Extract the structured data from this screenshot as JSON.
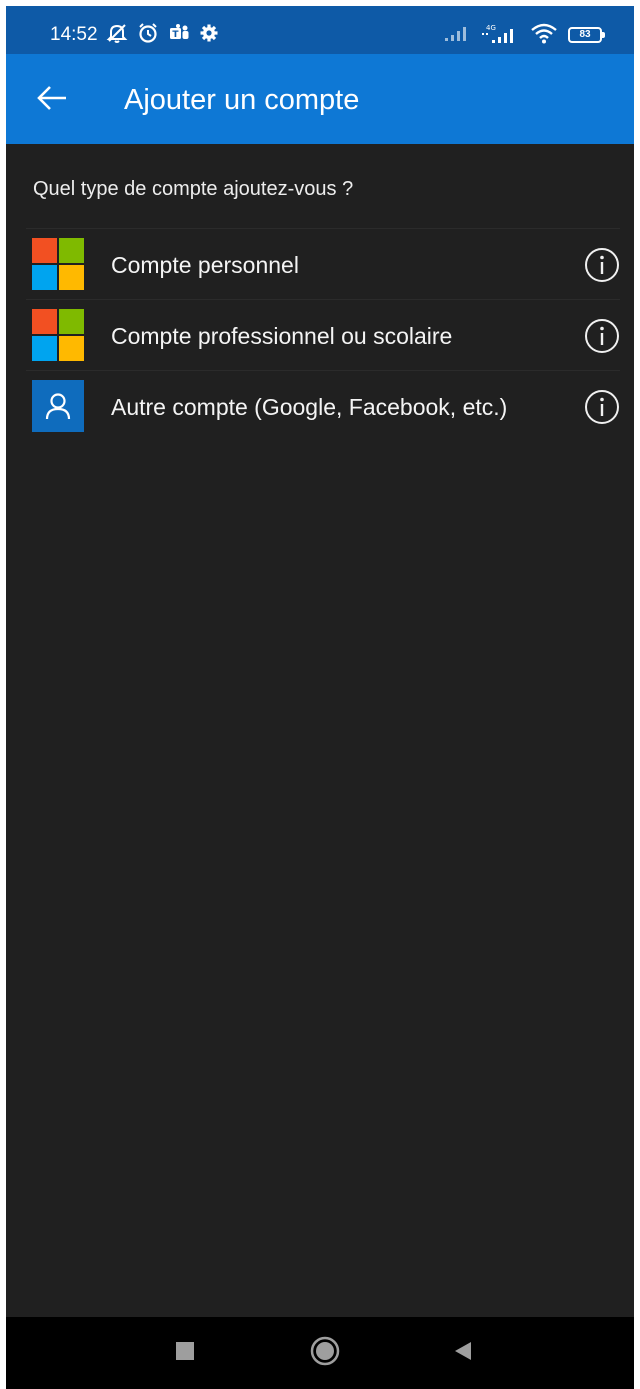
{
  "status_bar": {
    "time": "14:52",
    "battery_level": "83",
    "left_icons": [
      "muted-bell-icon",
      "alarm-icon",
      "teams-icon",
      "settings-icon"
    ],
    "right_icons": [
      "signal-icon",
      "signal-4g-icon",
      "wifi-icon",
      "battery-icon"
    ]
  },
  "app_bar": {
    "title": "Ajouter un compte",
    "back_icon": "arrow-left-icon"
  },
  "prompt": "Quel type de compte ajoutez-vous ?",
  "accounts": [
    {
      "label": "Compte personnel",
      "logo": "microsoft-logo",
      "info_icon": "info-icon"
    },
    {
      "label": "Compte professionnel ou scolaire",
      "logo": "microsoft-logo",
      "info_icon": "info-icon"
    },
    {
      "label": "Autre compte (Google, Facebook, etc.)",
      "logo": "person-icon",
      "info_icon": "info-icon"
    }
  ],
  "nav_bar": {
    "buttons": [
      "recents-square-icon",
      "home-circle-icon",
      "back-triangle-icon"
    ]
  },
  "colors": {
    "status_bar_bg": "#0e5aa7",
    "app_bar_bg": "#0e78d5",
    "content_bg": "#202020",
    "nav_bar_bg": "#000000",
    "ms_red": "#f25022",
    "ms_green": "#7fba00",
    "ms_blue": "#00a4ef",
    "ms_yellow": "#ffb900",
    "person_tile": "#0f6cbd"
  }
}
